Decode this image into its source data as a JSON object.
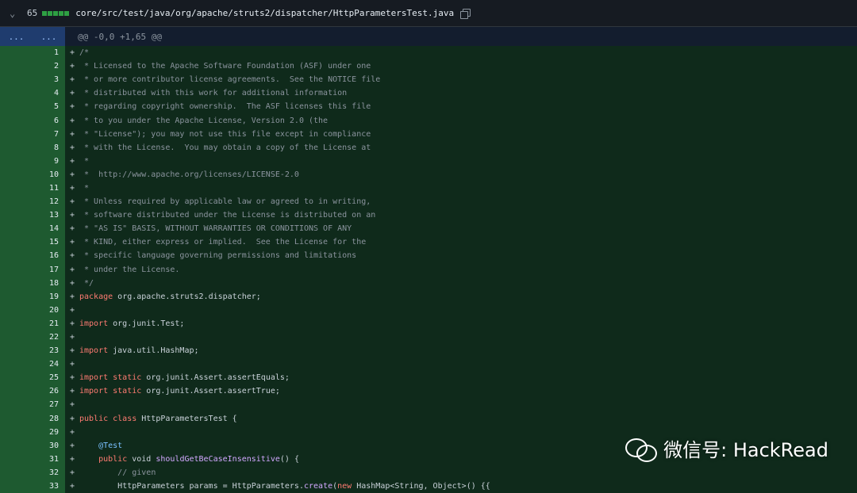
{
  "file_header": {
    "change_count": "65",
    "path": "core/src/test/java/org/apache/struts2/dispatcher/HttpParametersTest.java"
  },
  "hunk": {
    "expand_left": "...",
    "expand_right": "...",
    "header": "@@ -0,0 +1,65 @@"
  },
  "lines": [
    {
      "n": "1",
      "t": "/*",
      "c": "cmt"
    },
    {
      "n": "2",
      "t": " * Licensed to the Apache Software Foundation (ASF) under one",
      "c": "cmt"
    },
    {
      "n": "3",
      "t": " * or more contributor license agreements.  See the NOTICE file",
      "c": "cmt"
    },
    {
      "n": "4",
      "t": " * distributed with this work for additional information",
      "c": "cmt"
    },
    {
      "n": "5",
      "t": " * regarding copyright ownership.  The ASF licenses this file",
      "c": "cmt"
    },
    {
      "n": "6",
      "t": " * to you under the Apache License, Version 2.0 (the",
      "c": "cmt"
    },
    {
      "n": "7",
      "t": " * \"License\"); you may not use this file except in compliance",
      "c": "cmt"
    },
    {
      "n": "8",
      "t": " * with the License.  You may obtain a copy of the License at",
      "c": "cmt"
    },
    {
      "n": "9",
      "t": " *",
      "c": "cmt"
    },
    {
      "n": "10",
      "t": " *  http://www.apache.org/licenses/LICENSE-2.0",
      "c": "cmt"
    },
    {
      "n": "11",
      "t": " *",
      "c": "cmt"
    },
    {
      "n": "12",
      "t": " * Unless required by applicable law or agreed to in writing,",
      "c": "cmt"
    },
    {
      "n": "13",
      "t": " * software distributed under the License is distributed on an",
      "c": "cmt"
    },
    {
      "n": "14",
      "t": " * \"AS IS\" BASIS, WITHOUT WARRANTIES OR CONDITIONS OF ANY",
      "c": "cmt"
    },
    {
      "n": "15",
      "t": " * KIND, either express or implied.  See the License for the",
      "c": "cmt"
    },
    {
      "n": "16",
      "t": " * specific language governing permissions and limitations",
      "c": "cmt"
    },
    {
      "n": "17",
      "t": " * under the License.",
      "c": "cmt"
    },
    {
      "n": "18",
      "t": " */",
      "c": "cmt"
    },
    {
      "n": "19",
      "kw": "package",
      "t": " org.apache.struts2.dispatcher;"
    },
    {
      "n": "20",
      "t": ""
    },
    {
      "n": "21",
      "kw": "import",
      "t": " org.junit.Test;"
    },
    {
      "n": "22",
      "t": ""
    },
    {
      "n": "23",
      "kw": "import",
      "t": " java.util.HashMap;"
    },
    {
      "n": "24",
      "t": ""
    },
    {
      "n": "25",
      "kw": "import static",
      "t": " org.junit.Assert.assertEquals;"
    },
    {
      "n": "26",
      "kw": "import static",
      "t": " org.junit.Assert.assertTrue;"
    },
    {
      "n": "27",
      "t": ""
    },
    {
      "n": "28",
      "kw": "public class",
      "t": " HttpParametersTest {"
    },
    {
      "n": "29",
      "t": ""
    },
    {
      "n": "30",
      "pre": "    ",
      "ann": "@Test",
      "t": ""
    },
    {
      "n": "31",
      "pre": "    ",
      "kw": "public",
      "t2": " void ",
      "fn": "shouldGetBeCaseInsensitive",
      "t": "() {"
    },
    {
      "n": "32",
      "pre": "        ",
      "t": "// given",
      "c": "cmt"
    },
    {
      "n": "33",
      "pre": "        ",
      "t": "HttpParameters params = HttpParameters.",
      "fn": "create",
      "t3": "(",
      "kw2": "new",
      "t4": " HashMap<String, Object>() {{"
    }
  ],
  "watermark": {
    "text": "微信号: HackRead"
  }
}
